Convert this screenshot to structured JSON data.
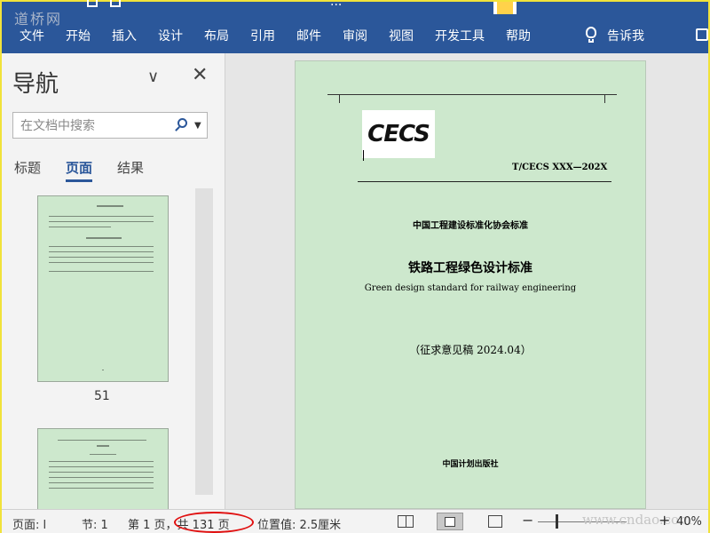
{
  "watermark_top": "道桥网",
  "watermark_bottom": "www.cndao.com",
  "title_fragment": "...",
  "ribbon": {
    "tabs": [
      "文件",
      "开始",
      "插入",
      "设计",
      "布局",
      "引用",
      "邮件",
      "审阅",
      "视图",
      "开发工具",
      "帮助"
    ],
    "tell_me": "告诉我"
  },
  "nav": {
    "title": "导航",
    "search_placeholder": "在文档中搜索",
    "tabs": [
      "标题",
      "页面",
      "结果"
    ],
    "active_tab": "页面",
    "thumb_label": "51"
  },
  "document": {
    "logo_text": "CECS",
    "code": "T/CECS XXX—202X",
    "association": "中国工程建设标准化协会标准",
    "title_cn": "铁路工程绿色设计标准",
    "title_en": "Green design standard for railway engineering",
    "draft": "（征求意见稿 2024.04）",
    "publisher": "中国计划出版社"
  },
  "status": {
    "page": "页面: l",
    "section": "节: 1",
    "page_of": "第 1 页，共 131 页",
    "position": "位置值: 2.5厘米",
    "zoom_minus": "−",
    "zoom_plus": "+",
    "zoom": "40%"
  },
  "colors": {
    "ribbon": "#2b579a",
    "page_bg": "#cde8cd",
    "highlight_oval": "#e01010"
  }
}
